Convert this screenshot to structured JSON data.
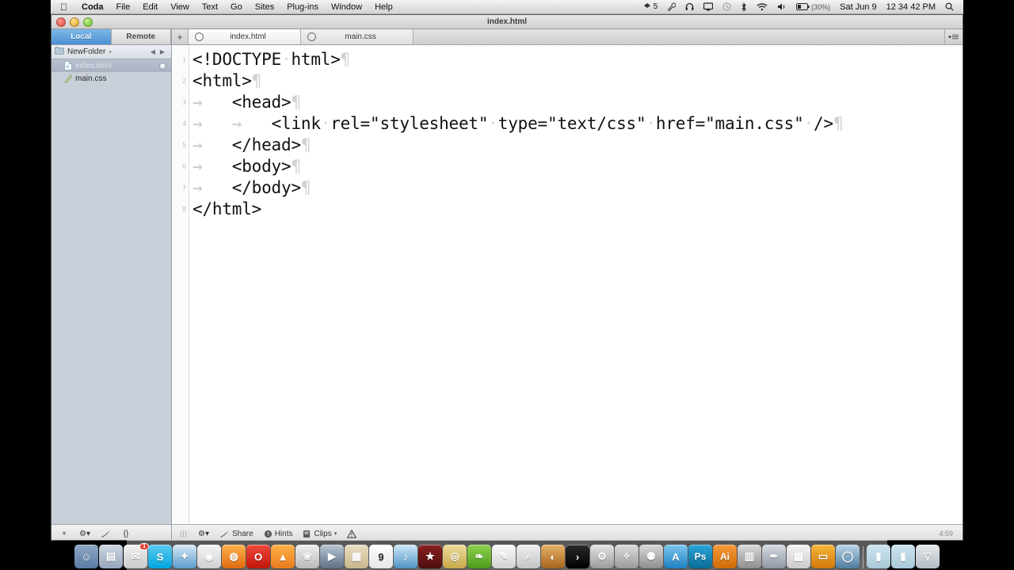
{
  "menubar": {
    "apple_icon": "apple-icon",
    "items": [
      {
        "label": "Coda",
        "bold": true
      },
      {
        "label": "File",
        "bold": false
      },
      {
        "label": "Edit",
        "bold": false
      },
      {
        "label": "View",
        "bold": false
      },
      {
        "label": "Text",
        "bold": false
      },
      {
        "label": "Go",
        "bold": false
      },
      {
        "label": "Sites",
        "bold": false
      },
      {
        "label": "Plug-ins",
        "bold": false
      },
      {
        "label": "Window",
        "bold": false
      },
      {
        "label": "Help",
        "bold": false
      }
    ],
    "status": {
      "dropbox_count": "5",
      "wrench_icon": "wrench-icon",
      "headphones_icon": "headphones-icon",
      "display_icon": "display-icon",
      "timemachine_icon": "clock-icon",
      "bluetooth_icon": "bluetooth-icon",
      "wifi_icon": "wifi-icon",
      "volume_icon": "volume-icon",
      "battery_icon": "battery-icon",
      "battery_percent": "(30%)",
      "date": "Sat Jun 9",
      "time": "12 34 42 PM",
      "search_icon": "search-icon"
    }
  },
  "window": {
    "title": "index.html",
    "traffic": {
      "close": "close-button",
      "minimize": "minimize-button",
      "zoom": "zoom-button"
    }
  },
  "sidebar": {
    "tabs": [
      {
        "label": "Local",
        "active": true
      },
      {
        "label": "Remote",
        "active": false
      }
    ],
    "add_label": "+",
    "folder": {
      "name": "NewFolder",
      "chevron": "▾",
      "back": "◀",
      "forward": "▶"
    },
    "files": [
      {
        "name": "index.html",
        "selected": true,
        "modified": true,
        "icon": "html-file-icon"
      },
      {
        "name": "main.css",
        "selected": false,
        "modified": false,
        "icon": "css-file-icon"
      }
    ],
    "bottom_buttons": [
      {
        "label": "+",
        "name": "add-file-button"
      },
      {
        "label": "⚙▾",
        "name": "action-gear-button"
      },
      {
        "label": "",
        "name": "publish-icon"
      },
      {
        "label": "{}",
        "name": "code-braces-button"
      }
    ]
  },
  "tabbar": {
    "add_label": "+",
    "tabs": [
      {
        "label": "index.html",
        "active": true
      },
      {
        "label": "main.css",
        "active": false
      }
    ],
    "panel_toggle": "panel-toggle-icon"
  },
  "editor": {
    "line_numbers": [
      "1",
      "2",
      "3",
      "4",
      "5",
      "6",
      "7",
      "8"
    ],
    "lines": [
      {
        "tabs": 0,
        "text": "<!DOCTYPE·html>",
        "pilcrow": true
      },
      {
        "tabs": 0,
        "text": "<html>",
        "pilcrow": true
      },
      {
        "tabs": 1,
        "text": "<head>",
        "pilcrow": true
      },
      {
        "tabs": 2,
        "text": "<link·rel=\"stylesheet\"·type=\"text/css\"·href=\"main.css\"·/>",
        "pilcrow": true
      },
      {
        "tabs": 1,
        "text": "</head>",
        "pilcrow": true
      },
      {
        "tabs": 1,
        "text": "<body>",
        "pilcrow": true
      },
      {
        "tabs": 1,
        "text": "</body>",
        "pilcrow": true
      },
      {
        "tabs": 0,
        "text": "</html>",
        "pilcrow": false
      }
    ]
  },
  "statusbar": {
    "grip": "|||",
    "gear_label": "⚙▾",
    "share_label": "Share",
    "hints_label": "Hints",
    "clips_label": "Clips",
    "clips_chevron": "▾",
    "validate_icon": "warning-triangle-icon",
    "time": "4:59"
  },
  "dock": {
    "items": [
      {
        "name": "finder",
        "label": "",
        "color1": "#8fa7c4",
        "color2": "#5b7ba6",
        "glyph": "☺"
      },
      {
        "name": "launchpad",
        "label": "",
        "color1": "#cfd8e3",
        "color2": "#96a6bd",
        "glyph": "▤"
      },
      {
        "name": "mail",
        "label": "",
        "color1": "#f2f2f2",
        "color2": "#c8c8c8",
        "glyph": "✉",
        "badge": "1"
      },
      {
        "name": "skype",
        "label": "S",
        "color1": "#5ecbf0",
        "color2": "#00a5e0",
        "glyph": "S"
      },
      {
        "name": "safari",
        "label": "",
        "color1": "#d8e9f6",
        "color2": "#5b9ccc",
        "glyph": "✦"
      },
      {
        "name": "chrome",
        "label": "",
        "color1": "#f5f5f5",
        "color2": "#d0d0d0",
        "glyph": "◉"
      },
      {
        "name": "firefox",
        "label": "",
        "color1": "#ffb24d",
        "color2": "#e06a10",
        "glyph": "◍"
      },
      {
        "name": "opera",
        "label": "O",
        "color1": "#ef4a3d",
        "color2": "#c3150a",
        "glyph": "O"
      },
      {
        "name": "vlc",
        "label": "",
        "color1": "#ffb34a",
        "color2": "#e87b1d",
        "glyph": "▲"
      },
      {
        "name": "photos",
        "label": "",
        "color1": "#efefef",
        "color2": "#b9b9b9",
        "glyph": "❀"
      },
      {
        "name": "facetime",
        "label": "",
        "color1": "#b9c6d4",
        "color2": "#5f7185",
        "glyph": "▶"
      },
      {
        "name": "contacts",
        "label": "",
        "color1": "#e9dfc5",
        "color2": "#c8b68b",
        "glyph": "▦"
      },
      {
        "name": "calendar",
        "label": "9",
        "color1": "#ffffff",
        "color2": "#e6e6e6",
        "glyph": "9"
      },
      {
        "name": "itunes",
        "label": "",
        "color1": "#cfe8f7",
        "color2": "#4f93c4",
        "glyph": "♪"
      },
      {
        "name": "imovie",
        "label": "",
        "color1": "#8c2020",
        "color2": "#4a0d0d",
        "glyph": "★"
      },
      {
        "name": "dvd-player",
        "label": "",
        "color1": "#efdc9a",
        "color2": "#c6a94a",
        "glyph": "◎"
      },
      {
        "name": "evernote",
        "label": "",
        "color1": "#8fd14f",
        "color2": "#4d9b1c",
        "glyph": "❧"
      },
      {
        "name": "textedit",
        "label": "",
        "color1": "#fafafa",
        "color2": "#d2d2d2",
        "glyph": "✎"
      },
      {
        "name": "preview",
        "label": "",
        "color1": "#f0f0f0",
        "color2": "#c4c4c4",
        "glyph": "⌕"
      },
      {
        "name": "photo-booth",
        "label": "",
        "color1": "#e8b26a",
        "color2": "#a5641c",
        "glyph": "◐"
      },
      {
        "name": "terminal",
        "label": "",
        "color1": "#2b2b2b",
        "color2": "#000000",
        "glyph": "›"
      },
      {
        "name": "system-preferences",
        "label": "",
        "color1": "#e4e4e4",
        "color2": "#9b9b9b",
        "glyph": "⚙"
      },
      {
        "name": "xcode",
        "label": "",
        "color1": "#dcdcdc",
        "color2": "#9a9a9a",
        "glyph": "✧"
      },
      {
        "name": "automator",
        "label": "",
        "color1": "#d9d9d9",
        "color2": "#8e8e8e",
        "glyph": "⚉"
      },
      {
        "name": "app-store",
        "label": "A",
        "color1": "#7fc7ef",
        "color2": "#1d7fc3",
        "glyph": "A"
      },
      {
        "name": "photoshop",
        "label": "Ps",
        "color1": "#2aa6d8",
        "color2": "#0b6a97",
        "glyph": "Ps"
      },
      {
        "name": "illustrator",
        "label": "Ai",
        "color1": "#f79b3b",
        "color2": "#cf6a06",
        "glyph": "Ai"
      },
      {
        "name": "dreamweaver",
        "label": "",
        "color1": "#dadada",
        "color2": "#8f8f8f",
        "glyph": "▥"
      },
      {
        "name": "coda",
        "label": "",
        "color1": "#d6dce3",
        "color2": "#8e97a3",
        "glyph": "✒"
      },
      {
        "name": "numbers",
        "label": "",
        "color1": "#f4f4f4",
        "color2": "#cbcbcb",
        "glyph": "▩"
      },
      {
        "name": "keynote",
        "label": "",
        "color1": "#f6b93b",
        "color2": "#d4770c",
        "glyph": "▭"
      },
      {
        "name": "disk-utility",
        "label": "",
        "color1": "#bcd6ea",
        "color2": "#4e7d9e",
        "glyph": "◯"
      },
      {
        "name": "documents-stack",
        "label": "",
        "color1": "#cfe4ef",
        "color2": "#a8c8d9",
        "glyph": "▮"
      },
      {
        "name": "downloads-stack",
        "label": "",
        "color1": "#cfe4ef",
        "color2": "#a8c8d9",
        "glyph": "▮"
      },
      {
        "name": "trash",
        "label": "",
        "color1": "#e6e9ec",
        "color2": "#b4bcc4",
        "glyph": "▽"
      }
    ]
  }
}
